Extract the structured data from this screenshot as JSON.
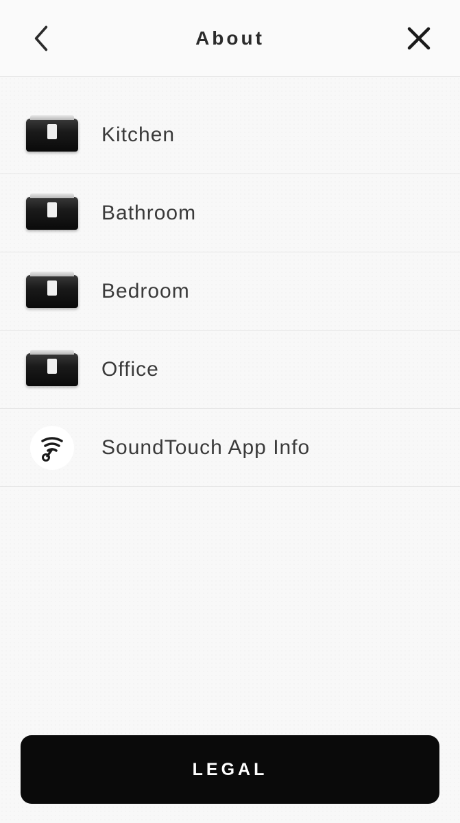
{
  "header": {
    "title": "About"
  },
  "items": [
    {
      "label": "Kitchen",
      "icon": "speaker"
    },
    {
      "label": "Bathroom",
      "icon": "speaker"
    },
    {
      "label": "Bedroom",
      "icon": "speaker"
    },
    {
      "label": "Office",
      "icon": "speaker"
    },
    {
      "label": "SoundTouch App Info",
      "icon": "app"
    }
  ],
  "footer": {
    "legal_label": "LEGAL"
  }
}
